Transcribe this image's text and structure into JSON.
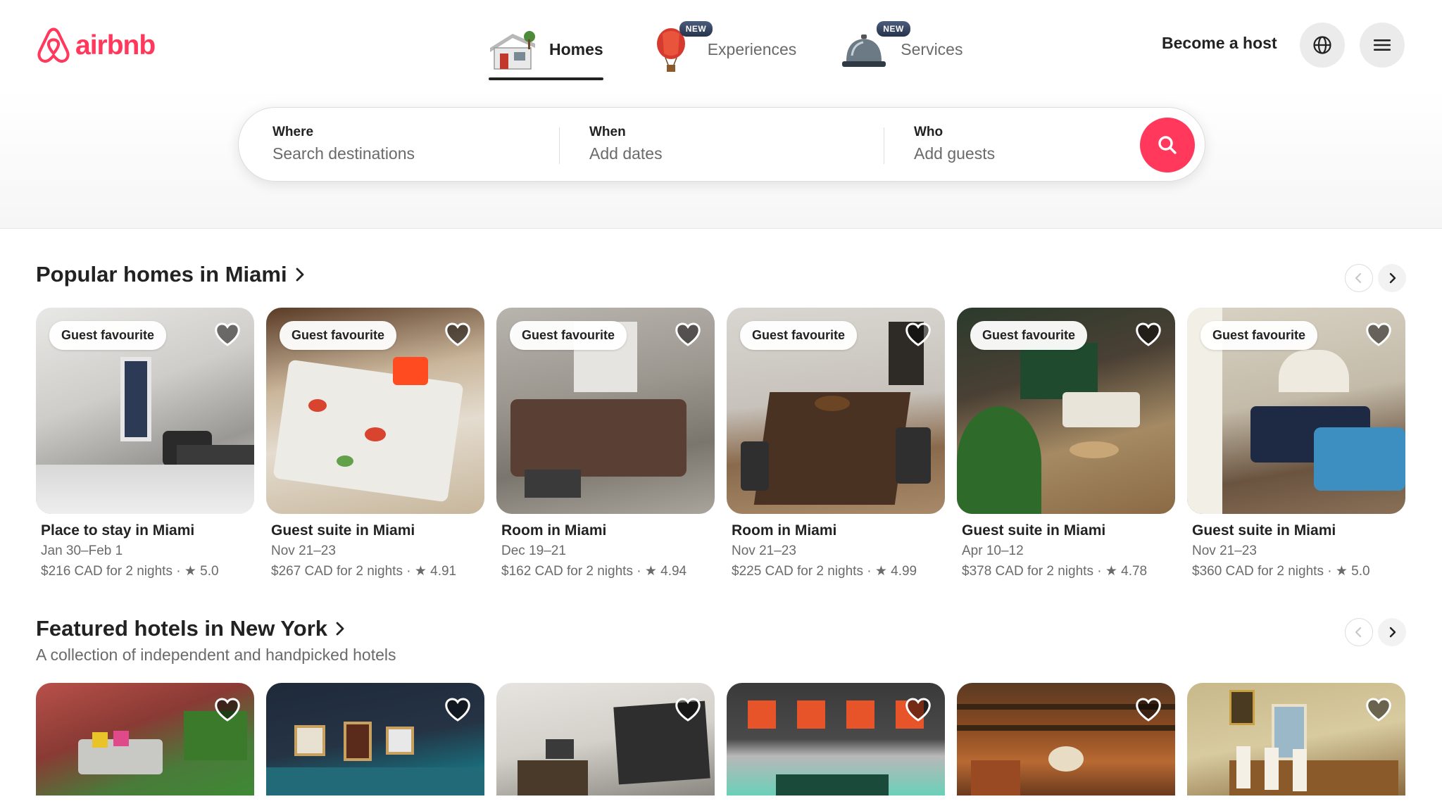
{
  "brand": {
    "name": "airbnb",
    "color": "#ff385c"
  },
  "nav": {
    "tabs": [
      {
        "label": "Homes",
        "icon": "house-icon",
        "active": true
      },
      {
        "label": "Experiences",
        "icon": "hot-air-balloon-icon",
        "badge": "NEW"
      },
      {
        "label": "Services",
        "icon": "service-bell-icon",
        "badge": "NEW"
      }
    ],
    "host_link": "Become a host",
    "globe_icon": "globe-icon",
    "menu_icon": "hamburger-menu-icon"
  },
  "search": {
    "where_label": "Where",
    "where_value": "Search destinations",
    "when_label": "When",
    "when_value": "Add dates",
    "who_label": "Who",
    "who_value": "Add guests",
    "button_icon": "search-icon"
  },
  "sections": [
    {
      "title": "Popular homes in Miami",
      "listings": [
        {
          "badge": "Guest favourite",
          "title": "Place to stay in Miami",
          "dates": "Jan 30–Feb 1",
          "price": "$216 CAD for 2 nights · ★ 5.0"
        },
        {
          "badge": "Guest favourite",
          "title": "Guest suite in Miami",
          "dates": "Nov 21–23",
          "price": "$267 CAD for 2 nights · ★ 4.91"
        },
        {
          "badge": "Guest favourite",
          "title": "Room in Miami",
          "dates": "Dec 19–21",
          "price": "$162 CAD for 2 nights · ★ 4.94"
        },
        {
          "badge": "Guest favourite",
          "title": "Room in Miami",
          "dates": "Nov 21–23",
          "price": "$225 CAD for 2 nights · ★ 4.99"
        },
        {
          "badge": "Guest favourite",
          "title": "Guest suite in Miami",
          "dates": "Apr 10–12",
          "price": "$378 CAD for 2 nights · ★ 4.78"
        },
        {
          "badge": "Guest favourite",
          "title": "Guest suite in Miami",
          "dates": "Nov 21–23",
          "price": "$360 CAD for 2 nights · ★ 5.0"
        }
      ]
    },
    {
      "title": "Featured hotels in New York",
      "subtitle": "A collection of independent and handpicked hotels"
    }
  ]
}
